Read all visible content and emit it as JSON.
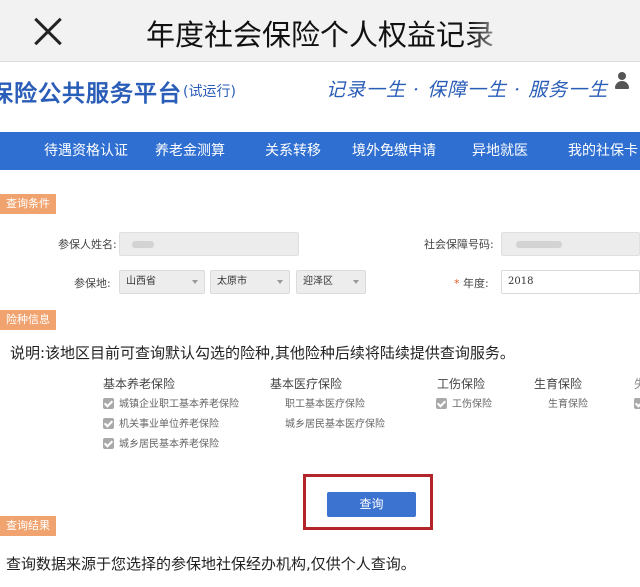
{
  "wechat": {
    "title": "年度社会保险个人权益记录"
  },
  "header": {
    "title": "保险公共服务平台",
    "subtitle": "(试运行)",
    "slogan": "记录一生 · 保障一生 · 服务一生"
  },
  "nav": {
    "items": [
      "待遇资格认证",
      "养老金测算",
      "关系转移",
      "境外免缴申请",
      "异地就医",
      "我的社保卡"
    ]
  },
  "query_section": {
    "tag": "查询条件",
    "name_label": "参保人姓名:",
    "ssn_label": "社会保障号码:",
    "location_label": "参保地:",
    "province": "山西省",
    "city": "太原市",
    "district": "迎泽区",
    "year_label": "年度:",
    "year_required_mark": "*",
    "year_value": "2018"
  },
  "insurance_section": {
    "tag": "险种信息",
    "note": "说明:该地区目前可查询默认勾选的险种,其他险种后续将陆续提供查询服务。",
    "categories": [
      {
        "name": "基本养老保险",
        "options": [
          "城镇企业职工基本养老保险",
          "机关事业单位养老保险",
          "城乡居民基本养老保险"
        ]
      },
      {
        "name": "基本医疗保险",
        "options": [
          "职工基本医疗保险",
          "城乡居民基本医疗保险"
        ]
      },
      {
        "name": "工伤保险",
        "options": [
          "工伤保险"
        ]
      },
      {
        "name": "生育保险",
        "options": [
          "生育保险"
        ]
      }
    ]
  },
  "query_button": "查询",
  "result_section": {
    "tag": "查询结果",
    "note": "查询数据来源于您选择的参保地社保经办机构,仅供个人查询。"
  }
}
